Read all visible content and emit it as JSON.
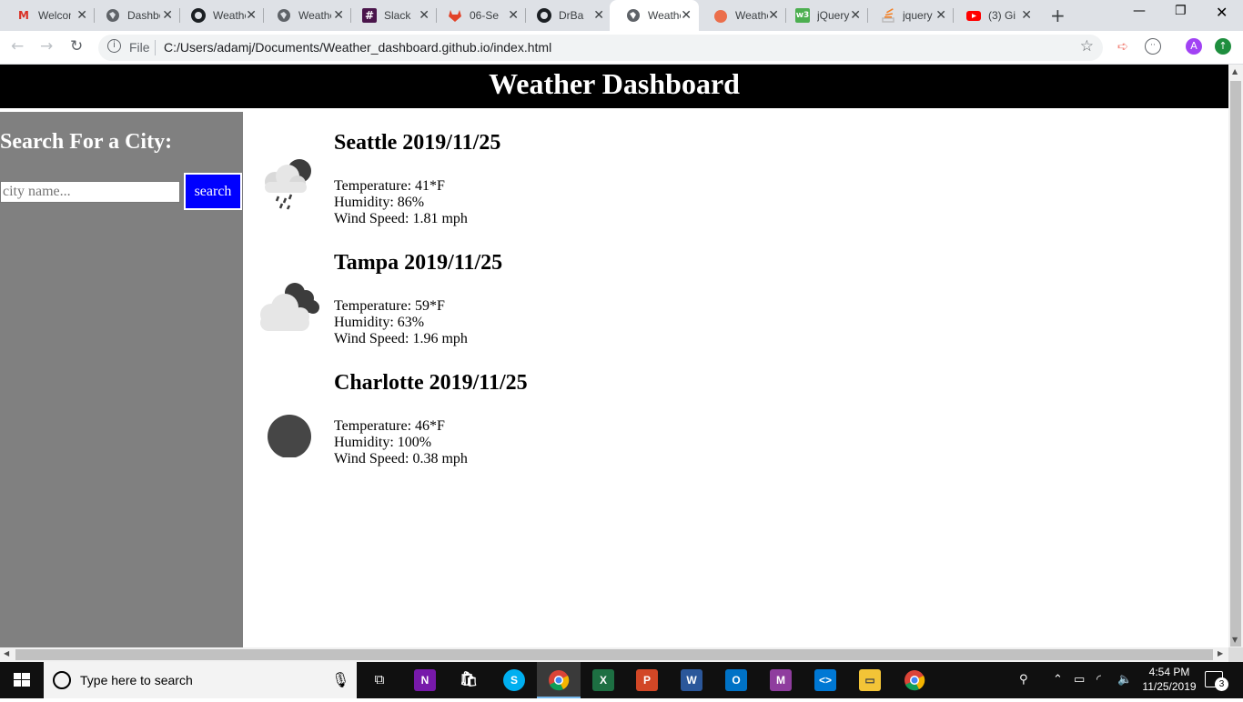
{
  "browser": {
    "tabs": [
      {
        "title": "Welcome",
        "favicon": "gmail-icon"
      },
      {
        "title": "Dashboard",
        "favicon": "globe-icon"
      },
      {
        "title": "Weather",
        "favicon": "github-icon"
      },
      {
        "title": "Weather",
        "favicon": "globe-icon"
      },
      {
        "title": "Slack",
        "favicon": "slack-icon"
      },
      {
        "title": "06-Se",
        "favicon": "gitlab-icon"
      },
      {
        "title": "DrBa",
        "favicon": "github-icon"
      },
      {
        "title": "Weather",
        "favicon": "globe-icon",
        "active": true
      },
      {
        "title": "Weather",
        "favicon": "weather-app-icon"
      },
      {
        "title": "jQuery",
        "favicon": "w3schools-icon"
      },
      {
        "title": "jquery",
        "favicon": "stackoverflow-icon"
      },
      {
        "title": "(3) Gi",
        "favicon": "youtube-icon"
      }
    ],
    "address": {
      "scheme_label": "File",
      "url": "C:/Users/adamj/Documents/Weather_dashboard.github.io/index.html"
    },
    "profile_initial": "A"
  },
  "page": {
    "header_title": "Weather Dashboard",
    "sidebar": {
      "heading": "Search For a City:",
      "search_placeholder": "city name...",
      "search_button": "search"
    },
    "cities": [
      {
        "title": "Seattle 2019/11/25",
        "icon": "rain-cloud-night-icon",
        "temperature": "Temperature: 41*F",
        "humidity": "Humidity: 86%",
        "wind": "Wind Speed: 1.81 mph"
      },
      {
        "title": "Tampa 2019/11/25",
        "icon": "broken-clouds-icon",
        "temperature": "Temperature: 59*F",
        "humidity": "Humidity: 63%",
        "wind": "Wind Speed: 1.96 mph"
      },
      {
        "title": "Charlotte 2019/11/25",
        "icon": "clear-night-icon",
        "temperature": "Temperature: 46*F",
        "humidity": "Humidity: 100%",
        "wind": "Wind Speed: 0.38 mph"
      }
    ]
  },
  "taskbar": {
    "search_text": "Type here to search",
    "time": "4:54 PM",
    "date": "11/25/2019",
    "notification_count": "3"
  }
}
